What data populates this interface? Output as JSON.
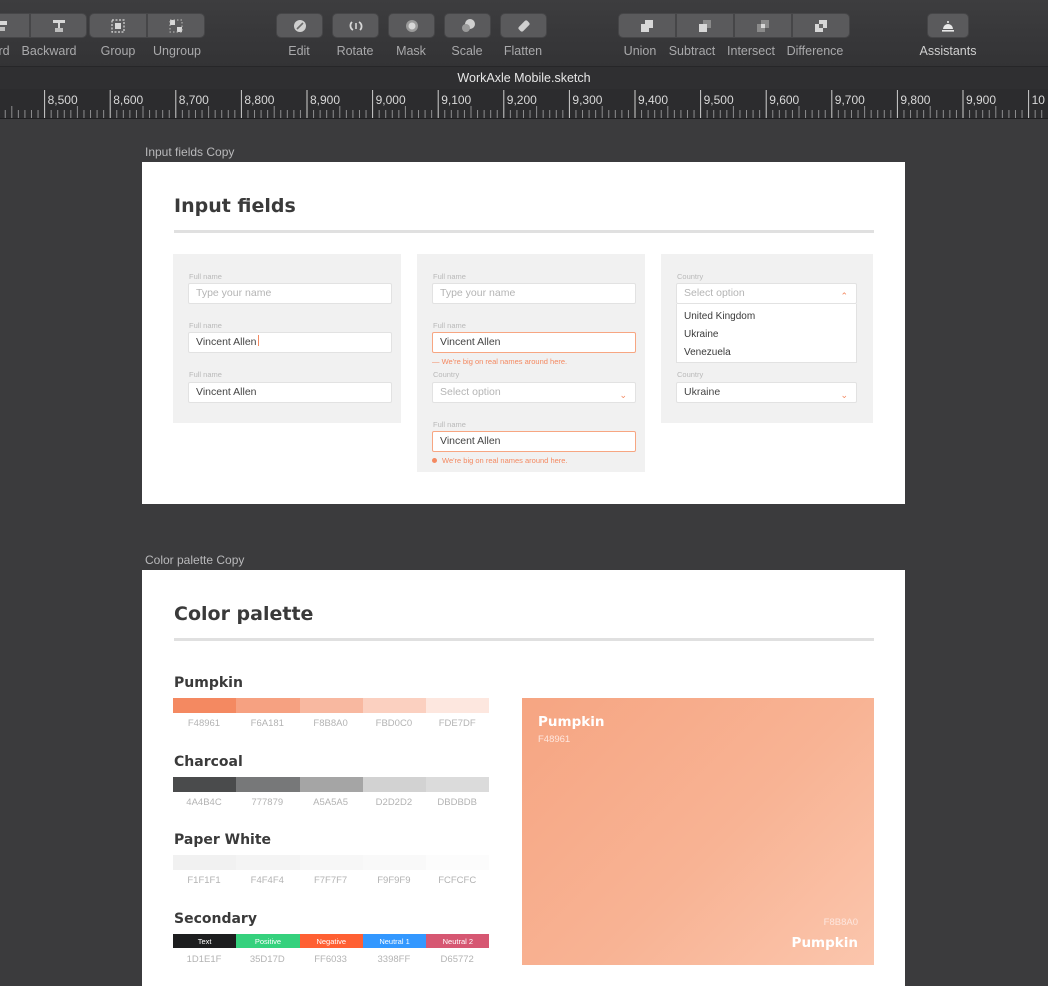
{
  "toolbar": {
    "buttons": [
      {
        "label": "rd",
        "icon": "forward-icon"
      },
      {
        "label": "Backward",
        "icon": "backward-icon"
      },
      {
        "label": "Group",
        "icon": "group-icon"
      },
      {
        "label": "Ungroup",
        "icon": "ungroup-icon"
      },
      {
        "label": "Edit",
        "icon": "edit-icon"
      },
      {
        "label": "Rotate",
        "icon": "rotate-icon"
      },
      {
        "label": "Mask",
        "icon": "mask-icon"
      },
      {
        "label": "Scale",
        "icon": "scale-icon"
      },
      {
        "label": "Flatten",
        "icon": "flatten-icon"
      },
      {
        "label": "Union",
        "icon": "union-icon"
      },
      {
        "label": "Subtract",
        "icon": "subtract-icon"
      },
      {
        "label": "Intersect",
        "icon": "intersect-icon"
      },
      {
        "label": "Difference",
        "icon": "difference-icon"
      },
      {
        "label": "Assistants",
        "icon": "assistants-icon"
      }
    ]
  },
  "window": {
    "title": "WorkAxle Mobile.sketch"
  },
  "ruler": {
    "labels": [
      "00",
      "8,500",
      "8,600",
      "8,700",
      "8,800",
      "8,900",
      "9,000",
      "9,100",
      "9,200",
      "9,300",
      "9,400",
      "9,500",
      "9,600",
      "9,700",
      "9,800",
      "9,900",
      "10"
    ]
  },
  "input_artboard": {
    "name": "Input fields Copy",
    "heading": "Input fields",
    "col1": {
      "label1": "Full name",
      "placeholder1": "Type your name",
      "label2": "Full name",
      "value2": "Vincent Allen",
      "label3": "Full name",
      "value3": "Vincent Allen"
    },
    "col2": {
      "label1": "Full name",
      "placeholder1": "Type your name",
      "label2": "Full name",
      "value2": "Vincent Allen",
      "error2": "— We're big on real names around here.",
      "label3": "Country",
      "select3": "Select option",
      "label4": "Full name",
      "value4": "Vincent Allen",
      "error4": "We're big on real names around here."
    },
    "col3": {
      "label1": "Country",
      "select1": "Select option",
      "options": [
        "United Kingdom",
        "Ukraine",
        "Venezuela"
      ],
      "label2": "Country",
      "select2": "Ukraine"
    }
  },
  "palette_artboard": {
    "name": "Color palette Copy",
    "heading": "Color palette",
    "groups": [
      {
        "name": "Pumpkin",
        "swatches": [
          {
            "code": "F48961",
            "color": "#F48961"
          },
          {
            "code": "F6A181",
            "color": "#F6A181"
          },
          {
            "code": "F8B8A0",
            "color": "#F8B8A0"
          },
          {
            "code": "FBD0C0",
            "color": "#FBD0C0"
          },
          {
            "code": "FDE7DF",
            "color": "#FDE7DF"
          }
        ]
      },
      {
        "name": "Charcoal",
        "swatches": [
          {
            "code": "4A4B4C",
            "color": "#4A4B4C"
          },
          {
            "code": "777879",
            "color": "#777879"
          },
          {
            "code": "A5A5A5",
            "color": "#A5A5A5"
          },
          {
            "code": "D2D2D2",
            "color": "#D2D2D2"
          },
          {
            "code": "DBDBDB",
            "color": "#DBDBDB"
          }
        ]
      },
      {
        "name": "Paper White",
        "swatches": [
          {
            "code": "F1F1F1",
            "color": "#F1F1F1"
          },
          {
            "code": "F4F4F4",
            "color": "#F4F4F4"
          },
          {
            "code": "F7F7F7",
            "color": "#F7F7F7"
          },
          {
            "code": "F9F9F9",
            "color": "#F9F9F9"
          },
          {
            "code": "FCFCFC",
            "color": "#FCFCFC"
          }
        ]
      },
      {
        "name": "Secondary",
        "swatches": [
          {
            "code": "1D1E1F",
            "color": "#1D1E1F",
            "label": "Text"
          },
          {
            "code": "35D17D",
            "color": "#35D17D",
            "label": "Positive"
          },
          {
            "code": "FF6033",
            "color": "#FF6033",
            "label": "Negative"
          },
          {
            "code": "3398FF",
            "color": "#3398FF",
            "label": "Neutral 1"
          },
          {
            "code": "D65772",
            "color": "#D65772",
            "label": "Neutral 2"
          }
        ]
      }
    ],
    "feature": {
      "top_name": "Pumpkin",
      "top_code": "F48961",
      "bottom_code": "F8B8A0",
      "bottom_name": "Pumpkin"
    }
  }
}
